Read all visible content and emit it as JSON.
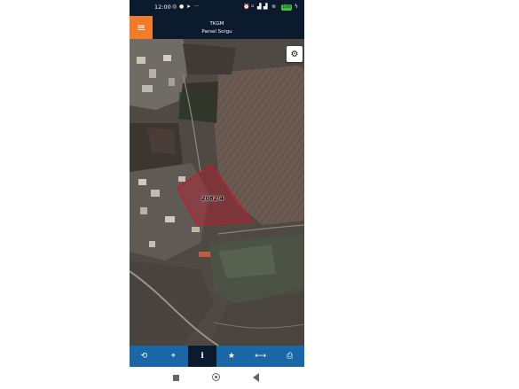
{
  "status_bar": {
    "time": "12:00",
    "left_icons": [
      "whatsapp-icon",
      "location-icon",
      "telegram-icon",
      "more-icon"
    ],
    "right_icons": [
      "alarm-icon",
      "sim-icon",
      "signal-icon",
      "signal-icon",
      "wifi-icon",
      "battery-icon",
      "charging-icon"
    ],
    "battery_level": "100"
  },
  "header": {
    "menu_icon": "hamburger-menu-icon",
    "title": "TKGM",
    "subtitle": "Parsel Sorgu",
    "accent_color": "#f07b2a",
    "bar_color": "#0b1a2c"
  },
  "map": {
    "parcel_label": "2082/4",
    "parcel_color": "#d0142c",
    "settings_icon": "gear-icon"
  },
  "toolbar": {
    "buttons": [
      {
        "icon": "refresh-icon",
        "glyph": "⟲"
      },
      {
        "icon": "locate-icon",
        "glyph": "⌖"
      },
      {
        "icon": "info-icon",
        "glyph": "i",
        "active": true
      },
      {
        "icon": "star-icon",
        "glyph": "★"
      },
      {
        "icon": "measure-icon",
        "glyph": "⟷"
      },
      {
        "icon": "print-icon",
        "glyph": "⎙"
      }
    ],
    "color": "#1a67a8"
  },
  "nav_bar": {
    "icons": [
      "recents-square-icon",
      "home-circle-icon",
      "back-triangle-icon"
    ]
  }
}
